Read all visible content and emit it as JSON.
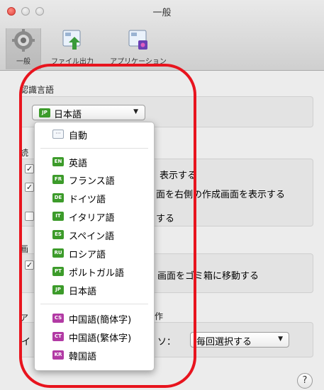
{
  "window": {
    "title": "一般"
  },
  "toolbar": {
    "items": [
      {
        "label": "一般",
        "icon": "gear-icon"
      },
      {
        "label": "ファイル出力",
        "icon": "file-export-icon"
      },
      {
        "label": "アプリケーション",
        "icon": "application-icon"
      }
    ]
  },
  "recognition": {
    "section_label": "認識言語",
    "selected_language": "日本語",
    "selected_code": "JP"
  },
  "background_labels": {
    "row1": "表示する",
    "row2": "面を右側の作成画面を表示する",
    "row3": "する",
    "row4": "画面をゴミ箱に移動する",
    "row5": "作",
    "row6": "ア",
    "row7": "画",
    "row8": "読",
    "row9": "イ",
    "row10": "ソ："
  },
  "action_popup": {
    "value": "毎回選択する"
  },
  "help": {
    "label": "?"
  },
  "menu": {
    "auto": {
      "label": "自動",
      "code": ""
    },
    "languages": [
      {
        "label": "英語",
        "code": "EN",
        "color": "#3c9b2a"
      },
      {
        "label": "フランス語",
        "code": "FR",
        "color": "#3c9b2a"
      },
      {
        "label": "ドイツ語",
        "code": "DE",
        "color": "#3c9b2a"
      },
      {
        "label": "イタリア語",
        "code": "IT",
        "color": "#3c9b2a"
      },
      {
        "label": "スペイン語",
        "code": "ES",
        "color": "#3c9b2a"
      },
      {
        "label": "ロシア語",
        "code": "RU",
        "color": "#3c9b2a"
      },
      {
        "label": "ポルトガル語",
        "code": "PT",
        "color": "#3c9b2a"
      },
      {
        "label": "日本語",
        "code": "JP",
        "color": "#3c9b2a"
      }
    ],
    "asian": [
      {
        "label": "中国語(簡体字)",
        "code": "CS",
        "color": "#b23aa4"
      },
      {
        "label": "中国語(繁体字)",
        "code": "CT",
        "color": "#b23aa4"
      },
      {
        "label": "韓国語",
        "code": "KR",
        "color": "#b23aa4"
      }
    ]
  },
  "colors": {
    "annotation": "#e8141e",
    "western_flag": "#3c9b2a",
    "asian_flag": "#b23aa4"
  }
}
